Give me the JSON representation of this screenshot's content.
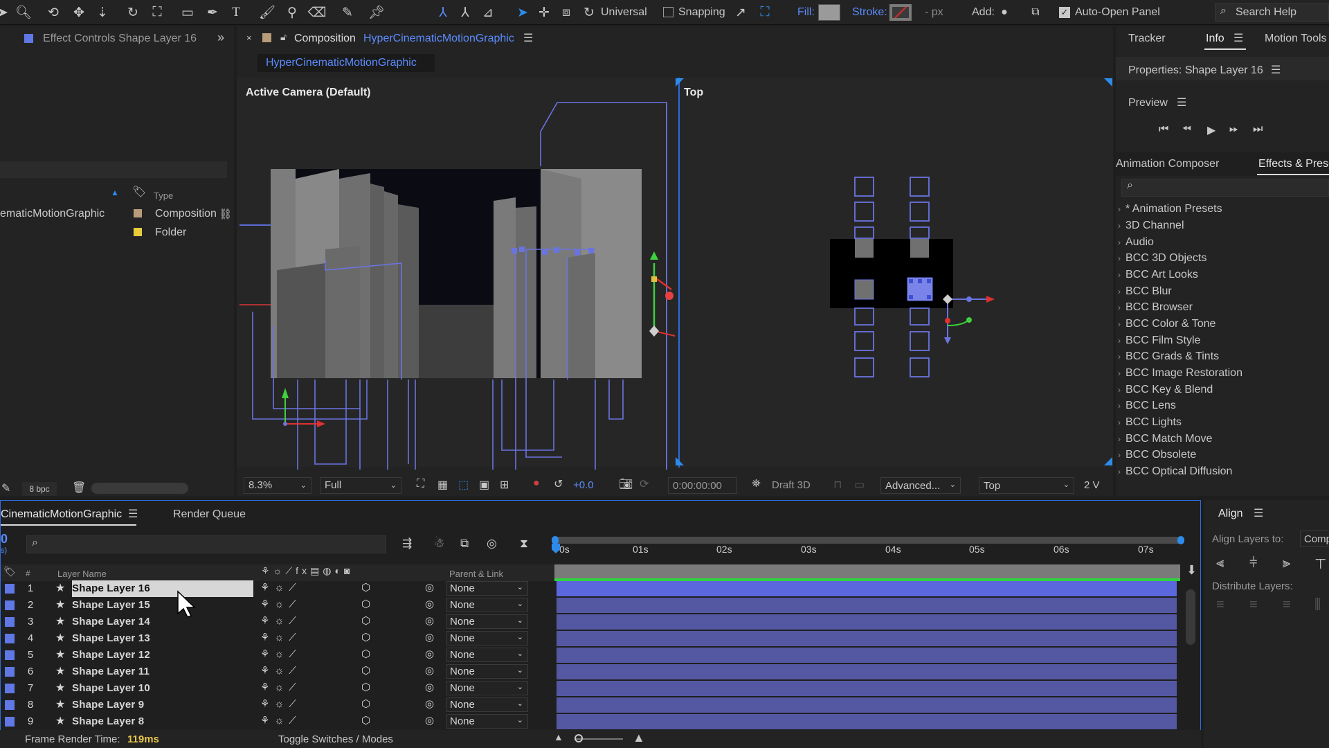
{
  "toolbar": {
    "universal_label": "Universal",
    "snapping_label": "Snapping",
    "fill_label": "Fill:",
    "stroke_label": "Stroke:",
    "px_label": "- px",
    "add_label": "Add:",
    "auto_open_label": "Auto-Open Panel",
    "search_help_label": "Search Help",
    "colors": {
      "fill": "#9a9a9a",
      "stroke_swatch": "#d22a2a",
      "accent": "#2d8ceb"
    }
  },
  "left_panel": {
    "tab_label": "Effect Controls Shape Layer 16",
    "type_header": "Type",
    "items": [
      {
        "name": "ematicMotionGraphic",
        "type": "Composition"
      },
      {
        "name": "",
        "type": "Folder"
      }
    ],
    "bpc_label": "8 bpc"
  },
  "composition": {
    "tab_prefix": "Composition",
    "tab_name": "HyperCinematicMotionGraphic",
    "breadcrumb": "HyperCinematicMotionGraphic",
    "left_view_label": "Active Camera (Default)",
    "right_view_label": "Top",
    "footer": {
      "zoom": "8.3%",
      "resolution": "Full",
      "exposure": "+0.0",
      "timecode": "0:00:00:00",
      "renderer": "Draft 3D",
      "advanced": "Advanced...",
      "view": "Top",
      "views_count": "2 V"
    }
  },
  "right_panel": {
    "tabs": [
      "Tracker",
      "Info",
      "Motion Tools"
    ],
    "properties_title": "Properties: Shape Layer 16",
    "preview_title": "Preview",
    "tabs2": [
      "Animation Composer",
      "Effects & Prese"
    ],
    "effects": [
      "* Animation Presets",
      "3D Channel",
      "Audio",
      "BCC 3D Objects",
      "BCC Art Looks",
      "BCC Blur",
      "BCC Browser",
      "BCC Color & Tone",
      "BCC Film Style",
      "BCC Grads & Tints",
      "BCC Image Restoration",
      "BCC Key & Blend",
      "BCC Lens",
      "BCC Lights",
      "BCC Match Move",
      "BCC Obsolete",
      "BCC Optical Diffusion"
    ]
  },
  "timeline": {
    "tab_label": "CinematicMotionGraphic",
    "render_queue_label": "Render Queue",
    "timecode_fragment": "0",
    "timecode_sub": "s)",
    "headers": {
      "num": "#",
      "layer_name": "Layer Name",
      "parent": "Parent & Link"
    },
    "ruler_labels": [
      "0s",
      "01s",
      "02s",
      "03s",
      "04s",
      "05s",
      "06s",
      "07s"
    ],
    "layers": [
      {
        "num": "1",
        "name": "Shape Layer 16",
        "parent": "None"
      },
      {
        "num": "2",
        "name": "Shape Layer 15",
        "parent": "None"
      },
      {
        "num": "3",
        "name": "Shape Layer 14",
        "parent": "None"
      },
      {
        "num": "4",
        "name": "Shape Layer 13",
        "parent": "None"
      },
      {
        "num": "5",
        "name": "Shape Layer 12",
        "parent": "None"
      },
      {
        "num": "6",
        "name": "Shape Layer 11",
        "parent": "None"
      },
      {
        "num": "7",
        "name": "Shape Layer 10",
        "parent": "None"
      },
      {
        "num": "8",
        "name": "Shape Layer 9",
        "parent": "None"
      },
      {
        "num": "9",
        "name": "Shape Layer 8",
        "parent": "None"
      }
    ],
    "frame_render_label": "Frame Render Time:",
    "frame_render_value": "119ms",
    "toggle_label": "Toggle Switches / Modes"
  },
  "align_panel": {
    "title": "Align",
    "align_to_label": "Align Layers to:",
    "align_to_value": "Comp",
    "distribute_label": "Distribute Layers:"
  }
}
